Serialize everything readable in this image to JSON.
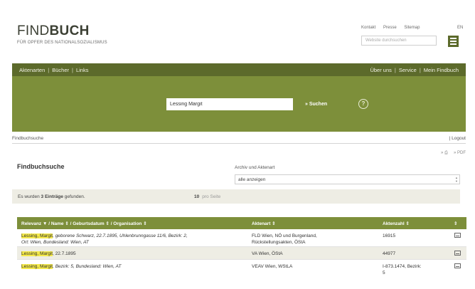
{
  "header": {
    "logo_light": "FIND",
    "logo_bold": "BUCH",
    "logo_subtitle": "FÜR OPFER DES NATIONALSOZIALISMUS",
    "top_links": [
      "Kontakt",
      "Presse",
      "Sitemap"
    ],
    "language": "EN",
    "search_placeholder": "Website durchsuchen"
  },
  "nav": {
    "left": [
      "Aktenarten",
      "Bücher",
      "Links"
    ],
    "right": [
      "Über uns",
      "Service",
      "Mein Findbuch"
    ]
  },
  "search": {
    "value": "Lessing Margit",
    "button": "» Suchen",
    "help": "?"
  },
  "breadcrumb": {
    "current": "Findbuchsuche",
    "logout": "| Logout"
  },
  "actions": {
    "print": "» ⎙",
    "pdf": "» PDF"
  },
  "page_title": "Findbuchsuche",
  "filter": {
    "label": "Archiv und Aktenart",
    "selected": "alle anzeigen"
  },
  "results": {
    "prefix": "Es wurden ",
    "count": "3 Einträge",
    "suffix": " gefunden.",
    "per_page_value": "10",
    "per_page_label": "pro Seite"
  },
  "table": {
    "headers": {
      "name": "Relevanz ▼ / Name ⇕ / Geburtsdatum ⇕ / Organisation ⇕",
      "aktenart": "Aktenart ⇕",
      "aktenzahl": "Aktenzahl ⇕",
      "icon": "⇕"
    },
    "rows": [
      {
        "name_hl": "Lessing, Margit",
        "name_rest_1": ", geborene Schwarz, 22.7.1895, Uhlenbrunngasse 11/6, Bezirk: 2,",
        "name_rest_2": "Ort: Wien, Bundesland: Wien, AT",
        "aktenart_1": "FLD Wien, NÖ und Burgenland,",
        "aktenart_2": "Rückstellungsakten, ÖStA",
        "aktenzahl": "16915"
      },
      {
        "name_hl": "Lessing, Margit",
        "name_rest_1": ", 22.7.1895",
        "name_rest_2": "",
        "aktenart_1": "VA Wien, ÖStA",
        "aktenart_2": "",
        "aktenzahl": "44977"
      },
      {
        "name_hl": "Lessing, Margit",
        "name_rest_1": ", Bezirk: 5, Bundesland: Wien, AT",
        "name_rest_2": "",
        "aktenart_1": "VEAV Wien, WStLA",
        "aktenart_2": "",
        "aktenzahl": "I-873.1474, Bezirk:",
        "aktenzahl_2": "5"
      }
    ]
  }
}
